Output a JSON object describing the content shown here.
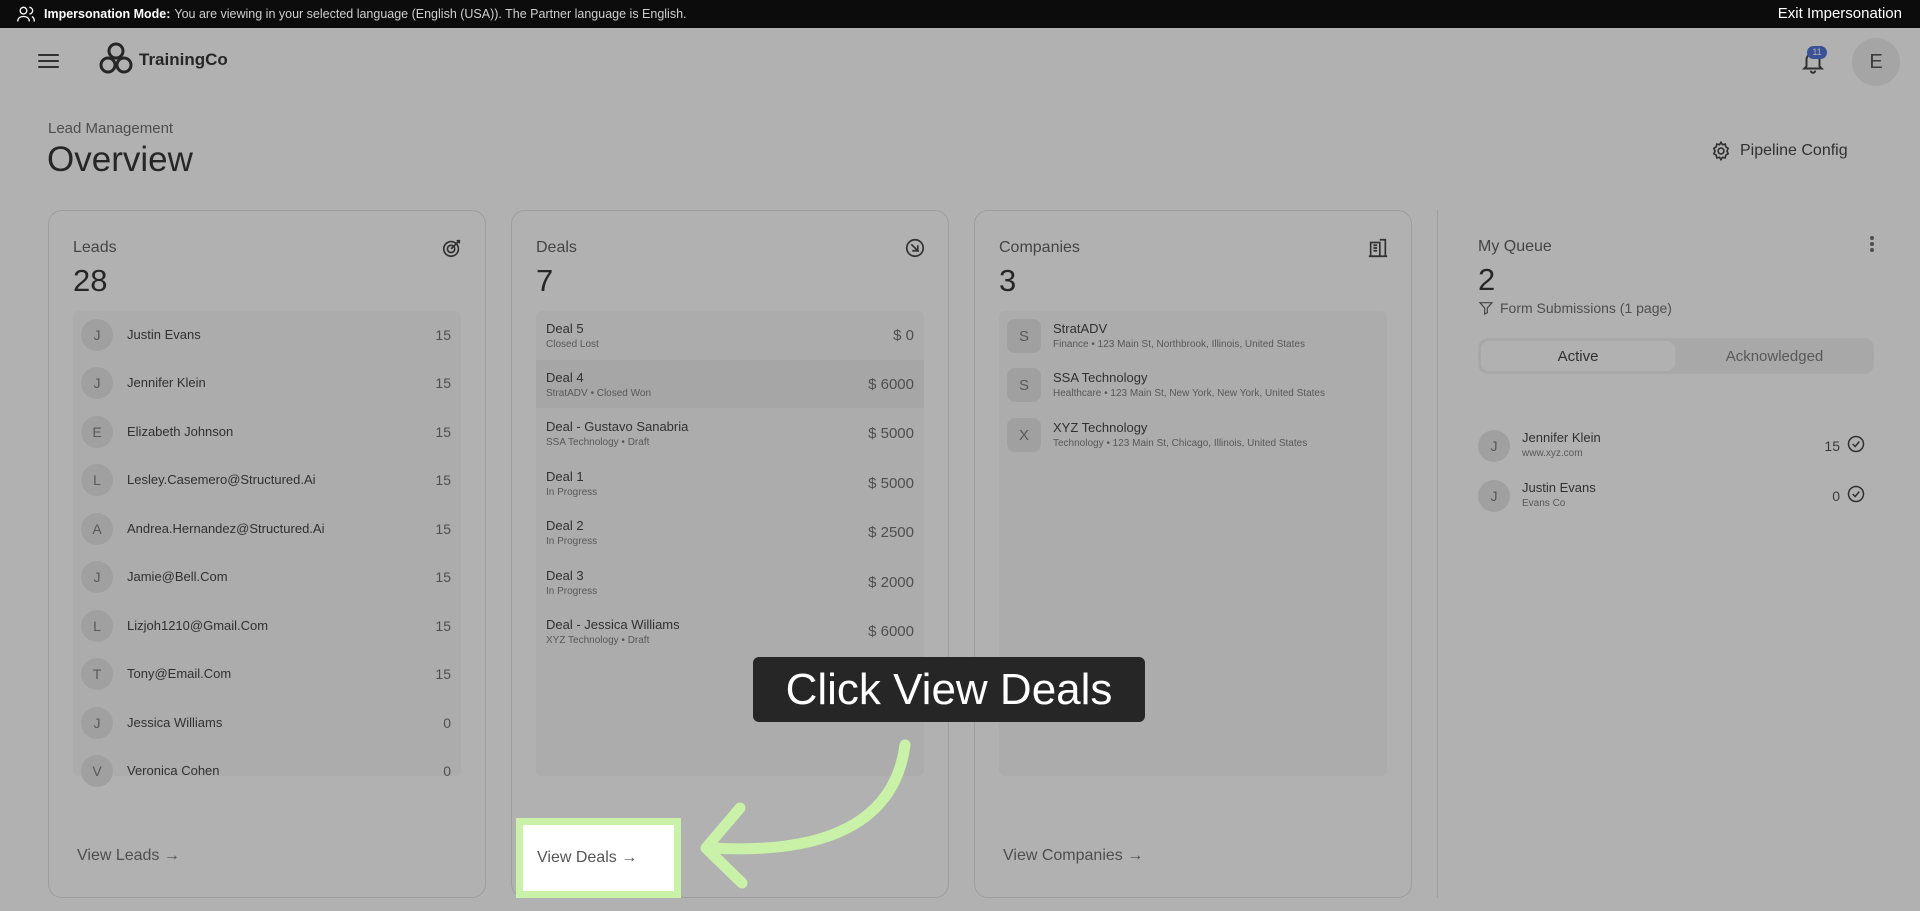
{
  "impersonation": {
    "label": "Impersonation Mode:",
    "message": "You are viewing in your selected language (English (USA)). The Partner language is English.",
    "exit_label": "Exit Impersonation"
  },
  "header": {
    "logo_text": "TrainingCo",
    "notification_count": "11",
    "avatar_initial": "E"
  },
  "page": {
    "breadcrumb": "Lead Management",
    "title": "Overview",
    "pipeline_config_label": "Pipeline Config"
  },
  "leads": {
    "label": "Leads",
    "count": "28",
    "items": [
      {
        "initial": "J",
        "name": "Justin Evans",
        "score": "15"
      },
      {
        "initial": "J",
        "name": "Jennifer Klein",
        "score": "15"
      },
      {
        "initial": "E",
        "name": "Elizabeth Johnson",
        "score": "15"
      },
      {
        "initial": "L",
        "name": "Lesley.Casemero@Structured.Ai",
        "score": "15"
      },
      {
        "initial": "A",
        "name": "Andrea.Hernandez@Structured.Ai",
        "score": "15"
      },
      {
        "initial": "J",
        "name": "Jamie@Bell.Com",
        "score": "15"
      },
      {
        "initial": "L",
        "name": "Lizjoh1210@Gmail.Com",
        "score": "15"
      },
      {
        "initial": "T",
        "name": "Tony@Email.Com",
        "score": "15"
      },
      {
        "initial": "J",
        "name": "Jessica Williams",
        "score": "0"
      },
      {
        "initial": "V",
        "name": "Veronica Cohen",
        "score": "0"
      }
    ],
    "view_link": "View Leads →"
  },
  "deals": {
    "label": "Deals",
    "count": "7",
    "items": [
      {
        "name": "Deal 5",
        "sub": "Closed Lost",
        "amount": "$ 0"
      },
      {
        "name": "Deal 4",
        "sub": "StratADV • Closed Won",
        "amount": "$ 6000"
      },
      {
        "name": "Deal - Gustavo Sanabria",
        "sub": "SSA Technology • Draft",
        "amount": "$ 5000"
      },
      {
        "name": "Deal 1",
        "sub": "In Progress",
        "amount": "$ 5000"
      },
      {
        "name": "Deal 2",
        "sub": "In Progress",
        "amount": "$ 2500"
      },
      {
        "name": "Deal 3",
        "sub": "In Progress",
        "amount": "$ 2000"
      },
      {
        "name": "Deal - Jessica Williams",
        "sub": "XYZ Technology • Draft",
        "amount": "$ 6000"
      }
    ],
    "view_link": "View Deals →"
  },
  "companies": {
    "label": "Companies",
    "count": "3",
    "items": [
      {
        "initial": "S",
        "name": "StratADV",
        "sub": "Finance • 123 Main St, Northbrook, Illinois, United States"
      },
      {
        "initial": "S",
        "name": "SSA Technology",
        "sub": "Healthcare • 123 Main St, New York, New York, United States"
      },
      {
        "initial": "X",
        "name": "XYZ Technology",
        "sub": "Technology • 123 Main St, Chicago, Illinois, United States"
      }
    ],
    "view_link": "View Companies →"
  },
  "queue": {
    "label": "My Queue",
    "count": "2",
    "filter_label": "Form Submissions (1 page)",
    "tabs": {
      "active": "Active",
      "acknowledged": "Acknowledged"
    },
    "items": [
      {
        "initial": "J",
        "name": "Jennifer Klein",
        "sub": "www.xyz.com",
        "score": "15"
      },
      {
        "initial": "J",
        "name": "Justin Evans",
        "sub": "Evans Co",
        "score": "0"
      }
    ]
  },
  "tutorial": {
    "callout_text": "Click View Deals",
    "highlight_color": "#c9f2a8"
  }
}
